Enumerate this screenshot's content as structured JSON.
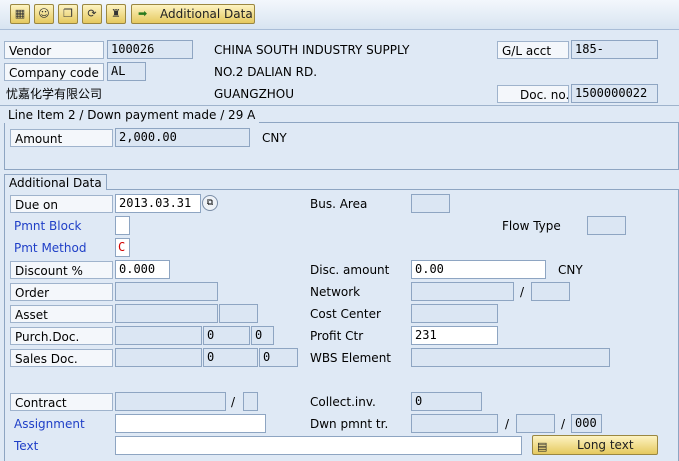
{
  "toolbar": {
    "icons": [
      "document-icon",
      "person-icon",
      "copy-icon",
      "refresh-icon",
      "stamp-icon"
    ],
    "additional_data_label": "Additional Data"
  },
  "header": {
    "vendor_label": "Vendor",
    "vendor_value": "100026",
    "vendor_name": "CHINA SOUTH INDUSTRY SUPPLY",
    "gl_acct_label": "G/L acct",
    "gl_acct_value": "185-",
    "company_code_label": "Company code",
    "company_code_value": "AL",
    "address_line": "NO.2 DALIAN RD.",
    "company_name": "忧嘉化学有限公司",
    "city": "GUANGZHOU",
    "doc_no_label": "Doc. no.",
    "doc_no_value": "1500000022"
  },
  "line_item": {
    "title": "Line Item 2 / Down payment made / 29 A",
    "amount_label": "Amount",
    "amount_value": "2,000.00",
    "currency": "CNY"
  },
  "additional": {
    "title": "Additional Data",
    "due_on_label": "Due on",
    "due_on_value": "2013.03.31",
    "bus_area_label": "Bus. Area",
    "bus_area_value": "",
    "pmnt_block_label": "Pmnt Block",
    "pmnt_block_value": "",
    "flow_type_label": "Flow Type",
    "flow_type_value": "",
    "pmt_method_label": "Pmt Method",
    "pmt_method_value": "C",
    "discount_label": "Discount %",
    "discount_value": "0.000",
    "disc_amount_label": "Disc. amount",
    "disc_amount_value": "0.00",
    "disc_currency": "CNY",
    "order_label": "Order",
    "network_label": "Network",
    "asset_label": "Asset",
    "cost_center_label": "Cost Center",
    "purch_doc_label": "Purch.Doc.",
    "purch_doc_item": "0",
    "purch_doc_sub": "0",
    "profit_ctr_label": "Profit Ctr",
    "profit_ctr_value": "231",
    "sales_doc_label": "Sales Doc.",
    "sales_doc_item": "0",
    "sales_doc_sub": "0",
    "wbs_label": "WBS Element",
    "contract_label": "Contract",
    "collect_inv_label": "Collect.inv.",
    "collect_inv_value": "0",
    "assignment_label": "Assignment",
    "assignment_value": "",
    "dwn_pmnt_label": "Dwn pmnt tr.",
    "dwn_pmnt_item": "000",
    "text_label": "Text",
    "text_value": "",
    "long_text_label": "Long text",
    "slash": "/"
  }
}
